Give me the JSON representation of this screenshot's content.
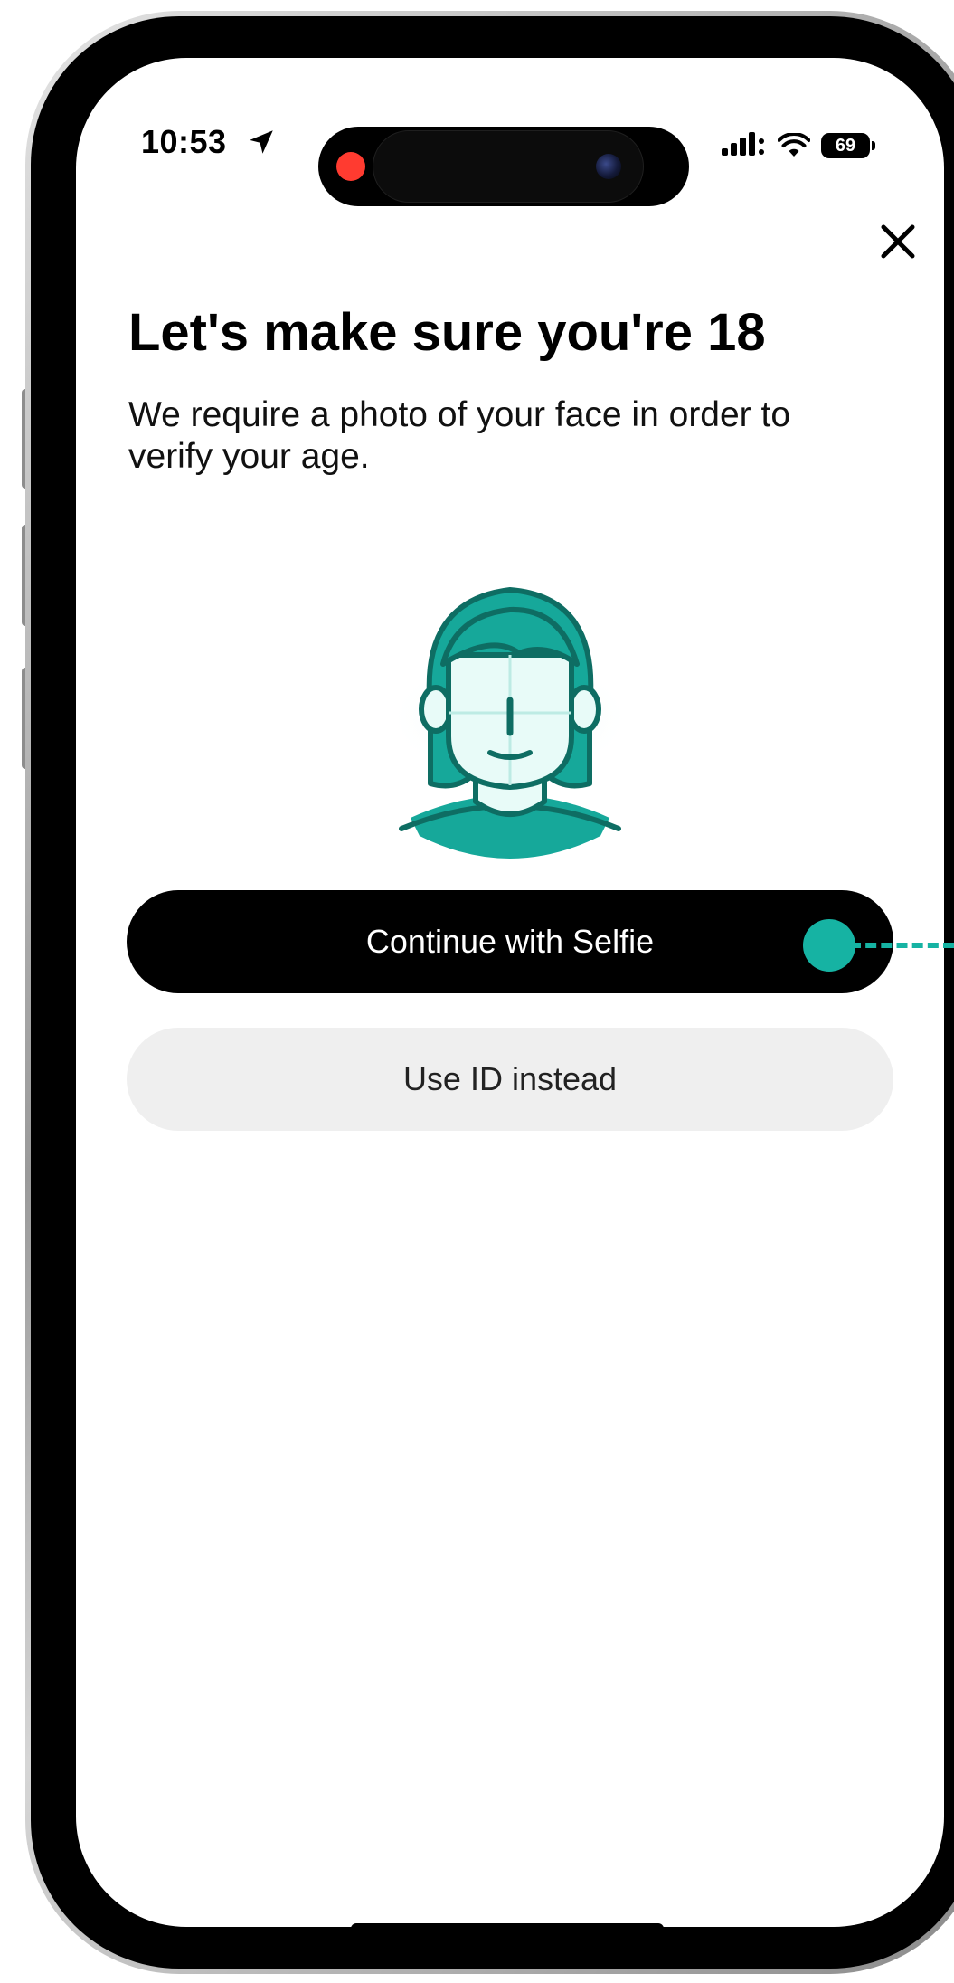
{
  "status_bar": {
    "time": "10:53",
    "battery_level": "69"
  },
  "screen": {
    "title": "Let's make sure you're 18",
    "subtitle": "We require a photo of your face in order to verify your age.",
    "close_icon": "close-icon",
    "illustration_icon": "selfie-face-icon"
  },
  "actions": {
    "primary_label": "Continue with Selfie",
    "secondary_label": "Use ID instead"
  },
  "colors": {
    "accent": "#16b3a3",
    "primary_button": "#000000",
    "secondary_button": "#efefef",
    "recording_indicator": "#ff3b30"
  }
}
